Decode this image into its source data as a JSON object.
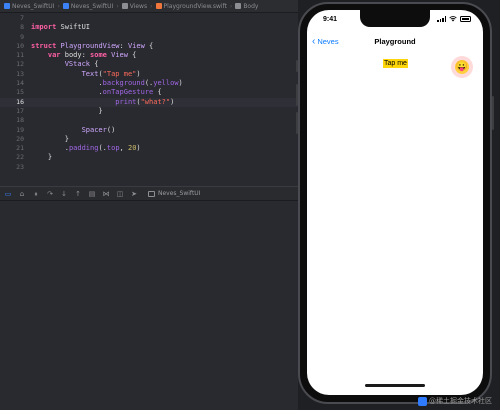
{
  "breadcrumb": {
    "items": [
      "Neves_SwiftUI",
      "Neves_SwiftUI",
      "Views",
      "PlaygroundView.swift",
      "Body"
    ]
  },
  "code": {
    "lines": [
      {
        "n": "7",
        "tokens": []
      },
      {
        "n": "8",
        "tokens": [
          [
            "kw",
            "import"
          ],
          [
            "pl",
            " SwiftUI"
          ]
        ]
      },
      {
        "n": "9",
        "tokens": []
      },
      {
        "n": "10",
        "tokens": [
          [
            "kw",
            "struct"
          ],
          [
            "pl",
            " "
          ],
          [
            "ty",
            "PlaygroundView"
          ],
          [
            "pl",
            ": "
          ],
          [
            "ty",
            "View"
          ],
          [
            "pl",
            " {"
          ]
        ]
      },
      {
        "n": "11",
        "tokens": [
          [
            "pl",
            "    "
          ],
          [
            "kw",
            "var"
          ],
          [
            "pl",
            " body: "
          ],
          [
            "kw",
            "some"
          ],
          [
            "pl",
            " "
          ],
          [
            "ty",
            "View"
          ],
          [
            "pl",
            " {"
          ]
        ]
      },
      {
        "n": "12",
        "tokens": [
          [
            "pl",
            "        "
          ],
          [
            "ty",
            "VStack"
          ],
          [
            "pl",
            " {"
          ]
        ]
      },
      {
        "n": "13",
        "tokens": [
          [
            "pl",
            "            "
          ],
          [
            "ty",
            "Text"
          ],
          [
            "pl",
            "("
          ],
          [
            "str",
            "\"Tap me\""
          ],
          [
            "pl",
            ")"
          ]
        ]
      },
      {
        "n": "14",
        "tokens": [
          [
            "pl",
            "                ."
          ],
          [
            "fn",
            "background"
          ],
          [
            "pl",
            "(."
          ],
          [
            "fn",
            "yellow"
          ],
          [
            "pl",
            ")"
          ]
        ]
      },
      {
        "n": "15",
        "tokens": [
          [
            "pl",
            "                ."
          ],
          [
            "fn",
            "onTapGesture"
          ],
          [
            "pl",
            " {"
          ]
        ]
      },
      {
        "n": "16",
        "tokens": [
          [
            "pl",
            "                    "
          ],
          [
            "fn",
            "print"
          ],
          [
            "pl",
            "("
          ],
          [
            "str",
            "\"what?\""
          ],
          [
            "pl",
            ")"
          ]
        ],
        "current": true
      },
      {
        "n": "17",
        "tokens": [
          [
            "pl",
            "                }"
          ]
        ]
      },
      {
        "n": "18",
        "tokens": []
      },
      {
        "n": "19",
        "tokens": [
          [
            "pl",
            "            "
          ],
          [
            "ty",
            "Spacer"
          ],
          [
            "pl",
            "()"
          ]
        ]
      },
      {
        "n": "20",
        "tokens": [
          [
            "pl",
            "        }"
          ]
        ]
      },
      {
        "n": "21",
        "tokens": [
          [
            "pl",
            "        ."
          ],
          [
            "fn",
            "padding"
          ],
          [
            "pl",
            "(."
          ],
          [
            "fn",
            "top"
          ],
          [
            "pl",
            ", "
          ],
          [
            "num",
            "20"
          ],
          [
            "pl",
            ")"
          ]
        ]
      },
      {
        "n": "22",
        "tokens": [
          [
            "pl",
            "    }"
          ]
        ]
      },
      {
        "n": "23",
        "tokens": []
      }
    ]
  },
  "debug": {
    "target_label": "Neves_SwiftUI"
  },
  "simulator": {
    "time": "9:41",
    "back_label": "Neves",
    "nav_title": "Playground",
    "button_text": "Tap me",
    "tap_indicator_emoji": "😛"
  },
  "watermark": {
    "text": "@稀土掘金技术社区"
  },
  "colors": {
    "accent_blue": "#0a7aff",
    "highlight_yellow": "#ffd60a",
    "keyword_pink": "#fc5fa3",
    "string_red": "#fc6a5d"
  }
}
